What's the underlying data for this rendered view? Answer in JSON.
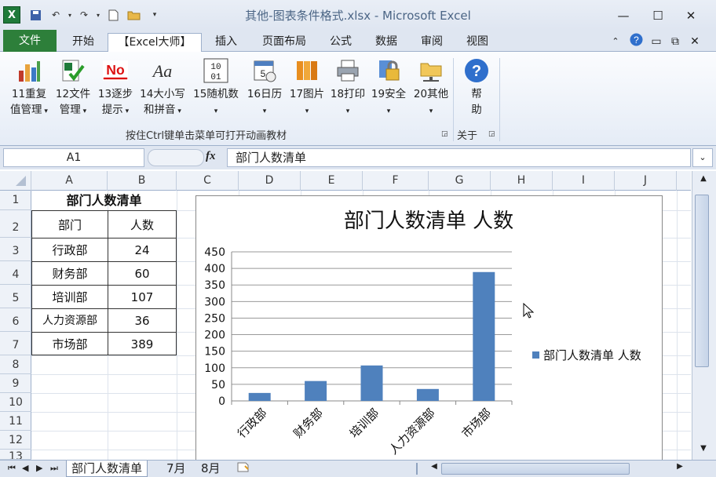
{
  "window": {
    "title": "其他-图表条件格式.xlsx - Microsoft Excel",
    "controls": [
      "—",
      "☐",
      "✕"
    ]
  },
  "ribbon_tabs": [
    "文件",
    "开始",
    "【Excel大师】",
    "插入",
    "页面布局",
    "公式",
    "数据",
    "审阅",
    "视图"
  ],
  "ribbon_buttons": [
    {
      "l1": "11重复",
      "l2": "值管理",
      "icon": "bar-chart-icon"
    },
    {
      "l1": "12文件",
      "l2": "管理",
      "icon": "excel-check-icon"
    },
    {
      "l1": "13逐步",
      "l2": "提示",
      "icon": "no-icon"
    },
    {
      "l1": "14大小写",
      "l2": "和拼音",
      "icon": "font-aa-icon"
    },
    {
      "l1": "15随机数",
      "l2": "",
      "icon": "binary-icon"
    },
    {
      "l1": "16日历",
      "l2": "",
      "icon": "calendar-icon"
    },
    {
      "l1": "17图片",
      "l2": "",
      "icon": "books-icon"
    },
    {
      "l1": "18打印",
      "l2": "",
      "icon": "printer-icon"
    },
    {
      "l1": "19安全",
      "l2": "",
      "icon": "lock-icon"
    },
    {
      "l1": "20其他",
      "l2": "",
      "icon": "folder-network-icon"
    }
  ],
  "help_button": {
    "l1": "帮",
    "l2": "助"
  },
  "ribbon_group_label": "按住Ctrl键单击菜单可打开动画教材",
  "ribbon_about_label": "关于",
  "name_box": "A1",
  "fx_label": "fx",
  "formula_value": "部门人数清单",
  "columns": [
    "A",
    "B",
    "C",
    "D",
    "E",
    "F",
    "G",
    "H",
    "I",
    "J"
  ],
  "rows": [
    "1",
    "2",
    "3",
    "4",
    "5",
    "6",
    "7",
    "8",
    "9",
    "10",
    "11",
    "12",
    "13"
  ],
  "table": {
    "title": "部门人数清单",
    "headers": [
      "部门",
      "人数"
    ],
    "rows": [
      [
        "行政部",
        "24"
      ],
      [
        "财务部",
        "60"
      ],
      [
        "培训部",
        "107"
      ],
      [
        "人力资源部",
        "36"
      ],
      [
        "市场部",
        "389"
      ]
    ]
  },
  "chart_data": {
    "type": "bar",
    "title": "部门人数清单 人数",
    "categories": [
      "行政部",
      "财务部",
      "培训部",
      "人力资源部",
      "市场部"
    ],
    "series": [
      {
        "name": "部门人数清单 人数",
        "values": [
          24,
          60,
          107,
          36,
          389
        ],
        "color": "#4f81bd"
      }
    ],
    "ylim": [
      0,
      450
    ],
    "yticks": [
      0,
      50,
      100,
      150,
      200,
      250,
      300,
      350,
      400,
      450
    ],
    "grid": true,
    "legend": "right"
  },
  "sheet_tabs": [
    "部门人数清单",
    "7月",
    "8月"
  ],
  "active_sheet": "部门人数清单"
}
